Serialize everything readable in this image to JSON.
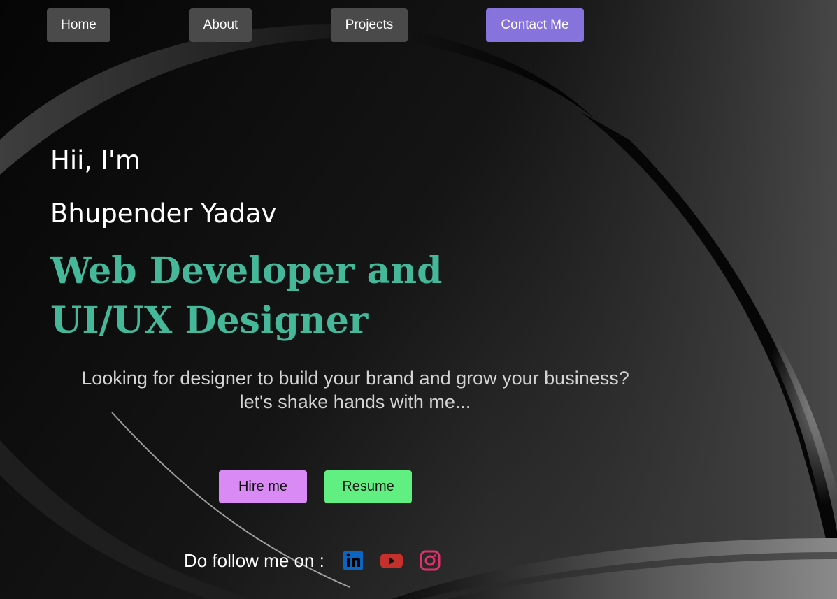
{
  "nav": {
    "home": "Home",
    "about": "About",
    "projects": "Projects",
    "contact": "Contact Me"
  },
  "hero": {
    "greeting": "Hii, I'm",
    "name": "Bhupender Yadav",
    "role_line1": "Web Developer and",
    "role_line2": "UI/UX Designer",
    "tagline_line1": "Looking for designer to build your brand and grow your business?",
    "tagline_line2": "let's shake hands with me..."
  },
  "buttons": {
    "hire": "Hire me",
    "resume": "Resume"
  },
  "social": {
    "label": "Do follow me on :",
    "icons": [
      "linkedin-icon",
      "youtube-icon",
      "instagram-icon"
    ]
  },
  "colors": {
    "accent_heading": "#44b898",
    "contact_button": "#8773dc",
    "hire_button": "#da8af5",
    "resume_button": "#62ef82",
    "nav_button": "#4a4a4a",
    "linkedin": "#0a66c2",
    "youtube": "#c4302b",
    "instagram": "#e1306c"
  }
}
